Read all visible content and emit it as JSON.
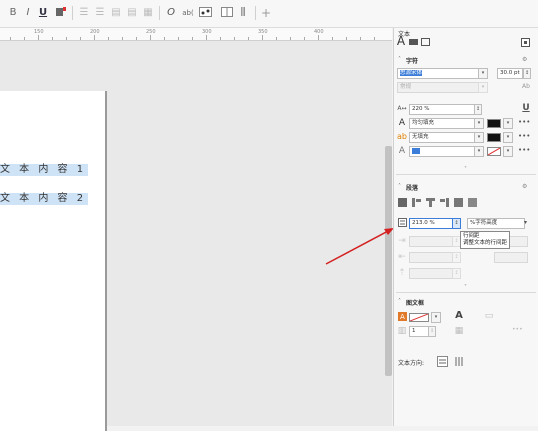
{
  "toolbar": {
    "bold": "B",
    "italic": "I",
    "underline": "U",
    "plus": "+"
  },
  "ruler": {
    "labels": [
      "150",
      "200",
      "250",
      "300",
      "350",
      "400"
    ]
  },
  "canvas": {
    "lines": [
      "文 本 内 容 1",
      "文 本 内 容 2"
    ]
  },
  "panel": {
    "title": "文本",
    "character": {
      "header": "字符",
      "font": "思源宋体",
      "font_size": "30.0 pt",
      "style": "常规",
      "scale": "220 %",
      "fill": "均匀填充",
      "outline": "无填充"
    },
    "paragraph": {
      "header": "段落",
      "line_spacing": "213.0 %",
      "spacing_unit": "%字符高度",
      "tooltip_title": "行间距",
      "tooltip_desc": "调整文本的行间距"
    },
    "frame": {
      "header": "图文框",
      "columns": "1",
      "direction_label": "文本方向:"
    }
  }
}
